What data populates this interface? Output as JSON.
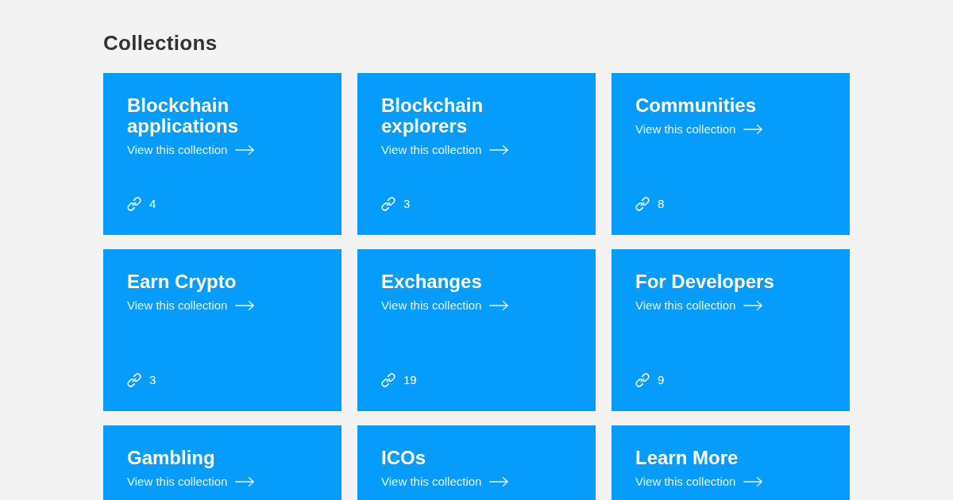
{
  "page": {
    "title": "Collections"
  },
  "collections": [
    {
      "title": "Blockchain applications",
      "link": "View this collection",
      "count": "4"
    },
    {
      "title": "Blockchain explorers",
      "link": "View this collection",
      "count": "3"
    },
    {
      "title": "Communities",
      "link": "View this collection",
      "count": "8"
    },
    {
      "title": "Earn Crypto",
      "link": "View this collection",
      "count": "3"
    },
    {
      "title": "Exchanges",
      "link": "View this collection",
      "count": "19"
    },
    {
      "title": "For Developers",
      "link": "View this collection",
      "count": "9"
    },
    {
      "title": "Gambling",
      "link": "View this collection"
    },
    {
      "title": "ICOs",
      "link": "View this collection"
    },
    {
      "title": "Learn More",
      "link": "View this collection"
    }
  ]
}
